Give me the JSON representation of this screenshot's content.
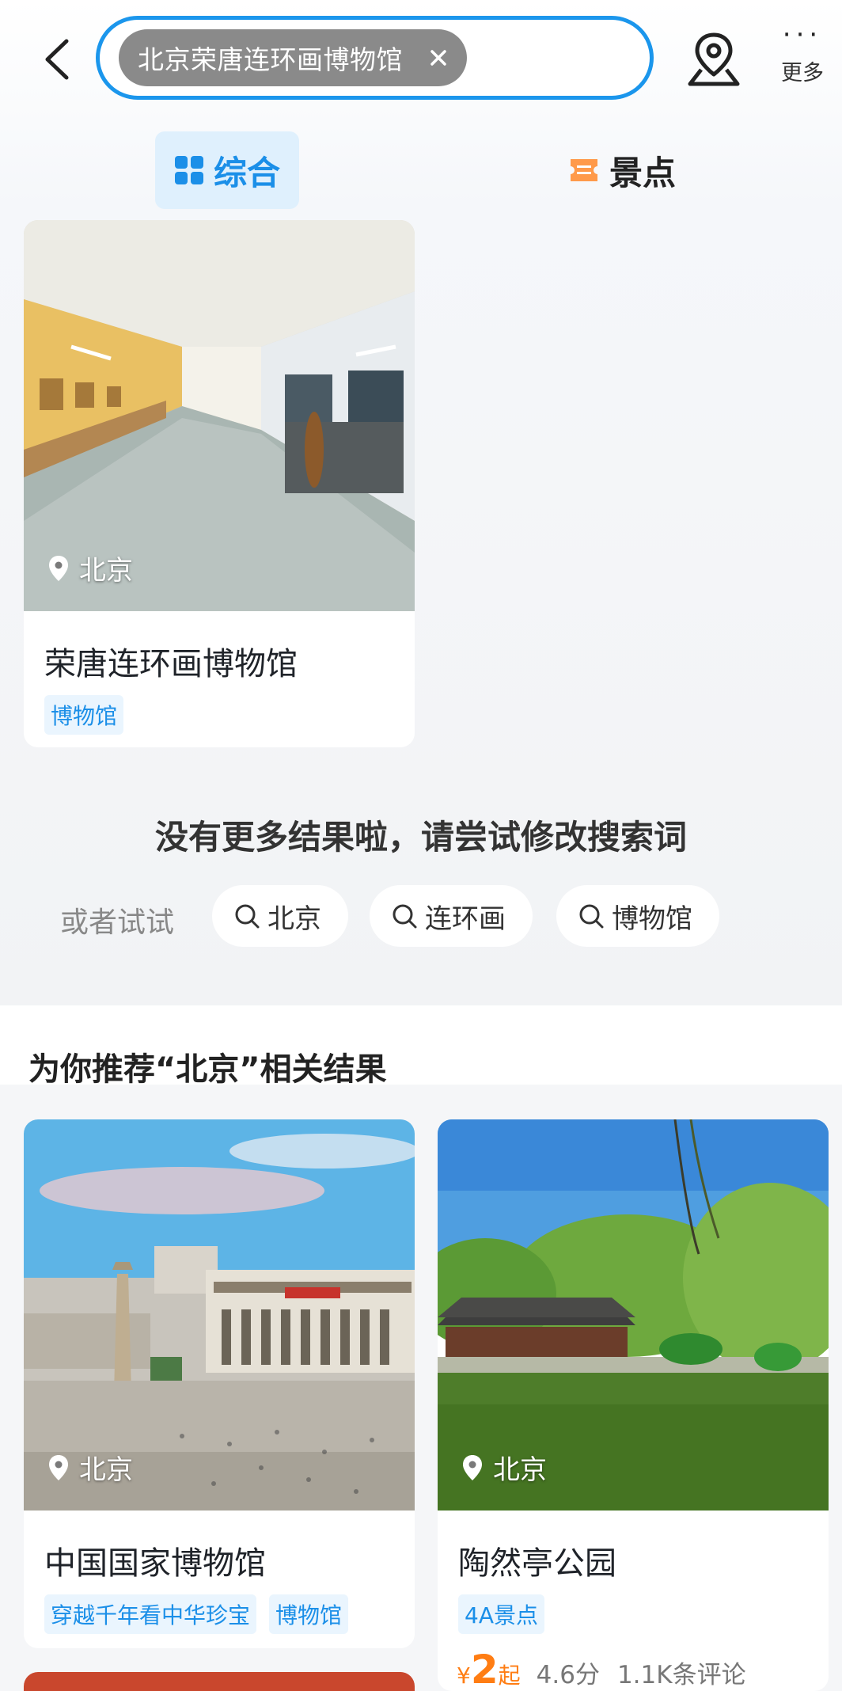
{
  "header": {
    "back_icon": "chevron-left-icon",
    "search_chip_text": "北京荣唐连环画博物馆",
    "map_icon": "map-pin-icon",
    "more_label": "更多",
    "more_dots": "···"
  },
  "tabs": [
    {
      "label": "综合",
      "active": true,
      "icon": "grid-icon"
    },
    {
      "label": "景点",
      "active": false,
      "icon": "ticket-icon"
    }
  ],
  "result": {
    "location": "北京",
    "title": "荣唐连环画博物馆",
    "tags": [
      "博物馆"
    ]
  },
  "no_more": {
    "message": "没有更多结果啦，请尝试修改搜索词",
    "try_label": "或者试试",
    "suggestions": [
      "北京",
      "连环画",
      "博物馆"
    ]
  },
  "recommend": {
    "title": "为你推荐“北京”相关结果",
    "cards": [
      {
        "location": "北京",
        "title": "中国国家博物馆",
        "tags": [
          "穿越千年看中华珍宝",
          "博物馆"
        ]
      },
      {
        "location": "北京",
        "title": "陶然亭公园",
        "tags": [
          "4A景点"
        ],
        "price_symbol": "¥",
        "price": "2",
        "price_suffix": "起",
        "score": "4.6分",
        "reviews": "1.1K条评论"
      }
    ]
  },
  "colors": {
    "accent": "#1b96ec",
    "tag_text": "#1b8fe8",
    "price": "#ff7d13"
  }
}
